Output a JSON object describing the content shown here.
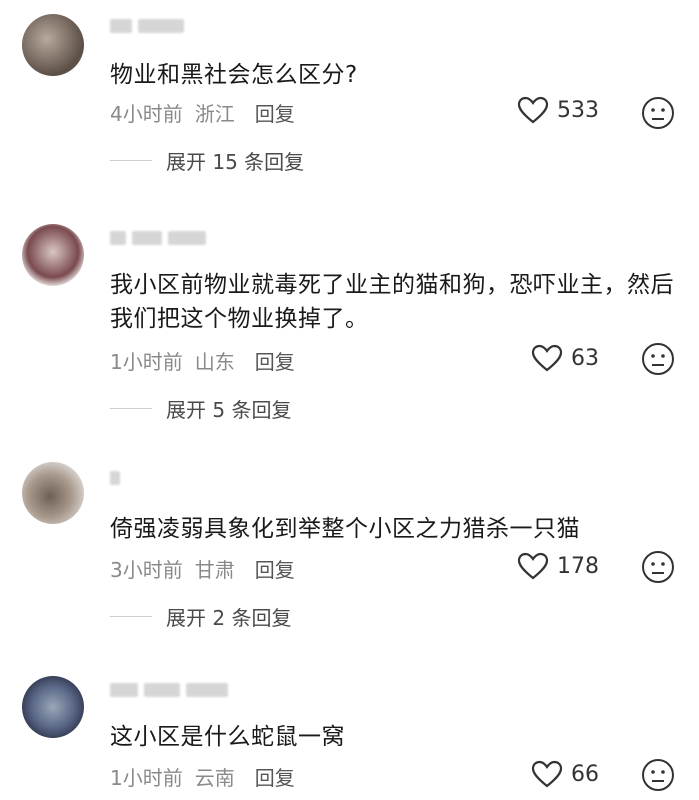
{
  "comments": [
    {
      "text": "物业和黑社会怎么区分?",
      "time": "4小时前",
      "location": "浙江",
      "reply_label": "回复",
      "likes": "533",
      "expand_label": "展开 15 条回复",
      "avatar_colors": [
        "#8c7f76",
        "#5b4e46",
        "#b8a99c"
      ]
    },
    {
      "text": "我小区前物业就毒死了业主的猫和狗，恐吓业主，然后我们把这个物业换掉了。",
      "time": "1小时前",
      "location": "山东",
      "reply_label": "回复",
      "likes": "63",
      "expand_label": "展开 5 条回复",
      "avatar_colors": [
        "#e7e2e0",
        "#7a4a4f",
        "#d9c7c3"
      ]
    },
    {
      "text": "倚强凌弱具象化到举整个小区之力猎杀一只猫",
      "time": "3小时前",
      "location": "甘肃",
      "reply_label": "回复",
      "likes": "178",
      "expand_label": "展开 2 条回复",
      "avatar_colors": [
        "#d8d3cf",
        "#6e6056",
        "#a9998c"
      ]
    },
    {
      "text": "这小区是什么蛇鼠一窝",
      "time": "1小时前",
      "location": "云南",
      "reply_label": "回复",
      "likes": "66",
      "expand_label": "",
      "avatar_colors": [
        "#5d6b8a",
        "#2b3148",
        "#9aa6b8"
      ]
    }
  ]
}
